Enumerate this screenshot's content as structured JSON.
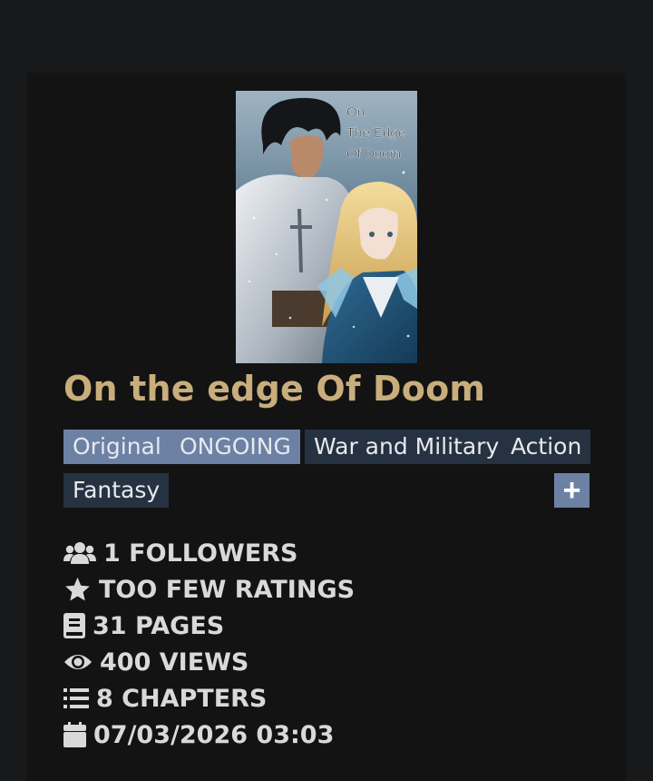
{
  "novel": {
    "title": "On the edge Of Doom",
    "cover": {
      "title_lines": [
        "On",
        "The Edge",
        "Of Doom"
      ]
    },
    "tags": [
      {
        "label": "Original",
        "style": "light"
      },
      {
        "label": "ONGOING",
        "style": "light"
      },
      {
        "label": "War and Military",
        "style": "dark"
      },
      {
        "label": "Action",
        "style": "dark"
      },
      {
        "label": "Fantasy",
        "style": "dark"
      }
    ],
    "add_button_label": "+",
    "stats": {
      "followers": "1 FOLLOWERS",
      "ratings": "TOO FEW RATINGS",
      "pages": "31 PAGES",
      "views": "400 VIEWS",
      "chapters": "8 CHAPTERS",
      "date": "07/03/2026 03:03"
    }
  },
  "icons": {
    "followers": "users-icon",
    "ratings": "star-icon",
    "pages": "book-icon",
    "views": "eye-icon",
    "chapters": "list-icon",
    "date": "calendar-icon"
  },
  "colors": {
    "page_bg": "#18191b",
    "card_bg": "#131313",
    "title": "#c9ae7c",
    "tag_light": "#6c81a4",
    "tag_dark": "#263241",
    "stat_text": "#d9d9d9"
  }
}
